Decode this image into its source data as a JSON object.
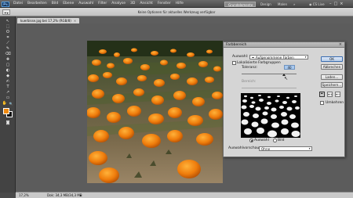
{
  "app": {
    "logo": "Ps",
    "menu": [
      "Datei",
      "Bearbeiten",
      "Bild",
      "Ebene",
      "Auswahl",
      "Filter",
      "Analyse",
      "3D",
      "Ansicht",
      "Fenster",
      "Hilfe"
    ],
    "workspaces": [
      "Grundelemente",
      "Design",
      "Malen",
      "»"
    ],
    "cs_live": "CS Live",
    "window_controls": [
      "–",
      "□",
      "×"
    ]
  },
  "options_bar": {
    "message": "Keine Optionen für aktuelles Werkzeug verfügbar"
  },
  "document": {
    "tab_label": "kuerbisse.jpg bei 17,2% (RGB/8)",
    "tab_close": "×",
    "zoom": "17,2%",
    "doc_info": "Dok: 34,3 MB/34,3 MB",
    "status_arrow": "▸"
  },
  "tools": {
    "items": [
      "↖",
      "⬚",
      "ʘ",
      "⌗",
      "⟋",
      "✎",
      "⌫",
      "✚",
      "▢",
      "◐",
      "◆",
      "✍",
      "T",
      "↗",
      "▭",
      "✋",
      "🔍"
    ],
    "foreground_color": "#f08a10",
    "background_color": "#111111"
  },
  "dialog": {
    "title": "Farbbereich",
    "close": "×",
    "auswahl_label": "Auswahl:",
    "auswahl_value": "Aufgenommene Farben",
    "lokalisierte_label": "Lokalisierte Farbgruppen",
    "toleranz_label": "Toleranz:",
    "toleranz_value": "40",
    "bereich_label": "Bereich:",
    "radio_auswahl": "Auswahl",
    "radio_bild": "Bild",
    "auswahlvorschau_label": "Auswahlvorschau:",
    "auswahlvorschau_value": "Ohne",
    "buttons": {
      "ok": "OK",
      "abbrechen": "Abbrechen",
      "laden": "Laden...",
      "speichern": "Speichern..."
    },
    "eyedroppers": [
      "✒",
      "✒+",
      "✒−"
    ],
    "umkehren_label": "Umkehren"
  }
}
